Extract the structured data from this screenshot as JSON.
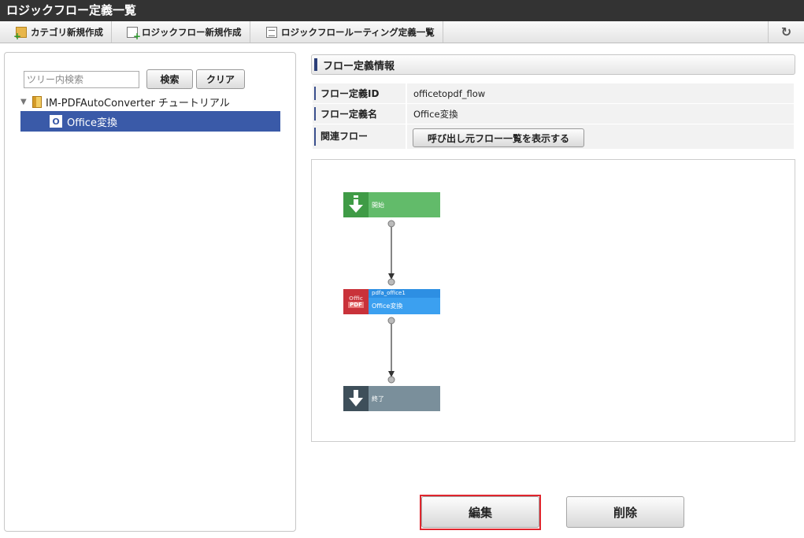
{
  "window": {
    "title": "ロジックフロー定義一覧"
  },
  "toolbar": {
    "new_category": "カテゴリ新規作成",
    "new_flow": "ロジックフロー新規作成",
    "routing_list": "ロジックフロールーティング定義一覧",
    "refresh_icon": "refresh-icon"
  },
  "tree": {
    "search_placeholder": "ツリー内検索",
    "search_label": "検索",
    "clear_label": "クリア",
    "root_label": "IM-PDFAutoConverter チュートリアル",
    "selected_label": "Office変換",
    "selected_badge": "O"
  },
  "info": {
    "section_title": "フロー定義情報",
    "id_label": "フロー定義ID",
    "id_value": "officetopdf_flow",
    "name_label": "フロー定義名",
    "name_value": "Office変換",
    "related_label": "関連フロー",
    "related_button": "呼び出し元フロー一覧を表示する"
  },
  "flow": {
    "start_label": "開始",
    "task_id": "pdfa_office1",
    "task_label": "Office変換",
    "end_label": "終了",
    "colors": {
      "start": "#62bb6a",
      "start_icon": "#3f9b46",
      "task": "#3ba0f0",
      "task_top": "#2d8fe3",
      "end": "#7a8f9b",
      "end_icon": "#3e4f5a"
    }
  },
  "actions": {
    "edit_label": "編集",
    "delete_label": "削除"
  }
}
